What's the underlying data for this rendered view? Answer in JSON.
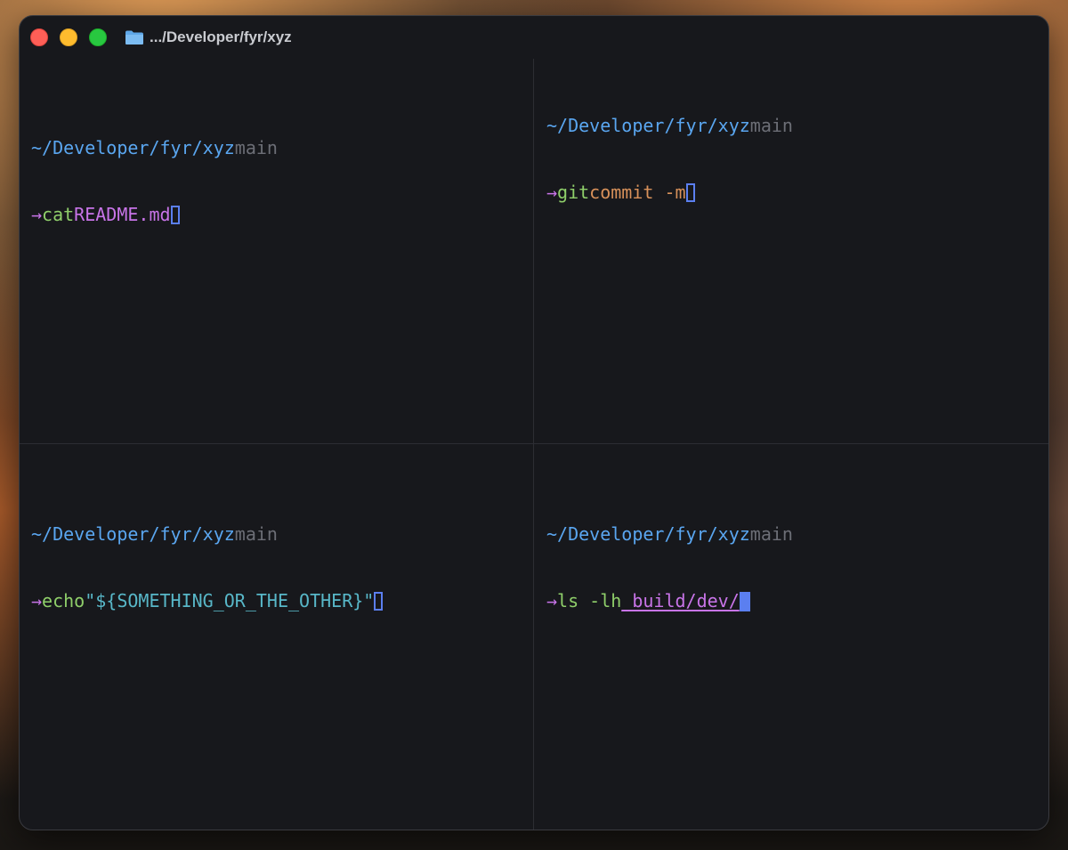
{
  "window": {
    "title": ".../Developer/fyr/xyz"
  },
  "panes": [
    {
      "path": "~/Developer/fyr/xyz",
      "branch": "main",
      "prompt": "→",
      "command": "cat",
      "argument": "README.md"
    },
    {
      "path": "~/Developer/fyr/xyz",
      "branch": "main",
      "prompt": "→",
      "command": "git",
      "argument": "commit -m"
    },
    {
      "path": "~/Developer/fyr/xyz",
      "branch": "main",
      "prompt": "→",
      "command": "echo",
      "argument": "\"${SOMETHING_OR_THE_OTHER}\""
    },
    {
      "path": "~/Developer/fyr/xyz",
      "branch": "main",
      "prompt": "→",
      "command": "ls -lh",
      "argument": "_build/dev/"
    }
  ],
  "colors": {
    "path": "#5aa6f0",
    "branch": "#6c6e76",
    "prompt": "#c874e8",
    "command": "#8fcf6a",
    "cursor": "#5b7ff0",
    "background": "#17181c"
  },
  "icons": {
    "title_icon": "folder-icon"
  }
}
